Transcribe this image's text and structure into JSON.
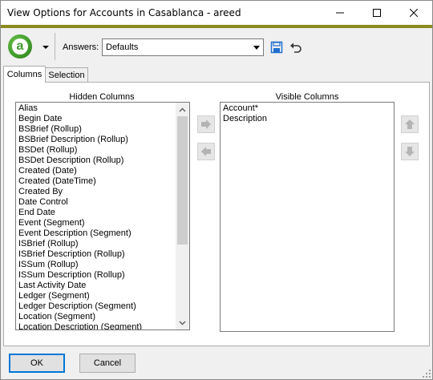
{
  "window": {
    "title": "View Options for Accounts in Casablanca - areed",
    "accent_color": "#8a8a20"
  },
  "toolbar": {
    "logo_letter": "a",
    "answers_label": "Answers:",
    "answers_value": "Defaults"
  },
  "tabs": [
    {
      "label": "Columns",
      "selected": true
    },
    {
      "label": "Selection",
      "selected": false
    }
  ],
  "hidden_columns": {
    "heading": "Hidden Columns",
    "items": [
      "Alias",
      "Begin Date",
      "BSBrief (Rollup)",
      "BSBrief Description (Rollup)",
      "BSDet (Rollup)",
      "BSDet Description (Rollup)",
      "Created (Date)",
      "Created (DateTime)",
      "Created By",
      "Date Control",
      "End Date",
      "Event (Segment)",
      "Event Description (Segment)",
      "ISBrief (Rollup)",
      "ISBrief Description (Rollup)",
      "ISSum (Rollup)",
      "ISSum Description (Rollup)",
      "Last Activity Date",
      "Ledger (Segment)",
      "Ledger Description (Segment)",
      "Location (Segment)",
      "Location Description (Segment)"
    ]
  },
  "visible_columns": {
    "heading": "Visible Columns",
    "items": [
      "Account*",
      "Description"
    ]
  },
  "buttons": {
    "ok": "OK",
    "cancel": "Cancel"
  },
  "icons": {
    "minimize": "minimize-icon",
    "maximize": "maximize-icon",
    "close": "close-icon",
    "save": "save-icon",
    "undo": "undo-icon",
    "move_right": "arrow-right-icon",
    "move_left": "arrow-left-icon",
    "move_up": "arrow-up-icon",
    "move_down": "arrow-down-icon"
  }
}
